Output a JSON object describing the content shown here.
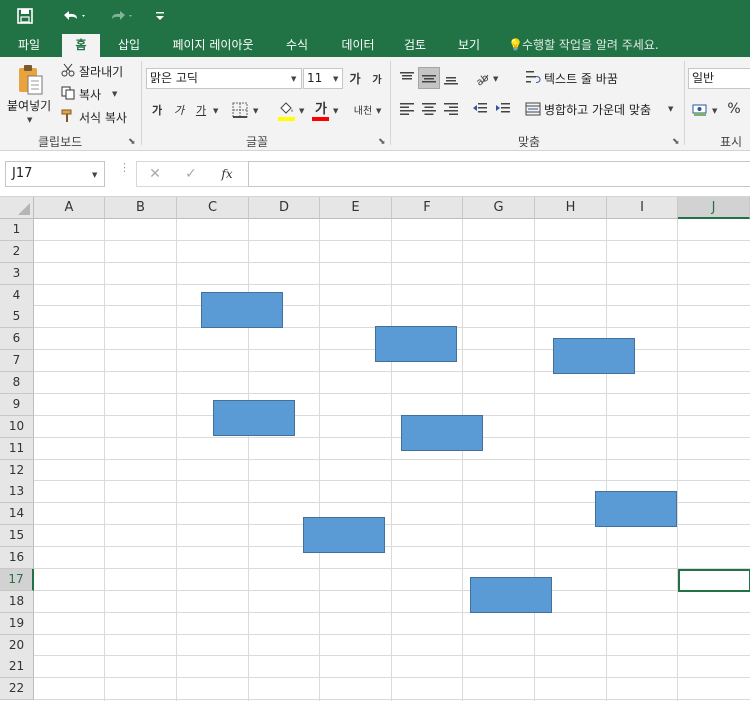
{
  "quick_access": {
    "save_icon": "save-icon",
    "undo_icon": "undo-icon",
    "redo_icon": "redo-icon",
    "customize_icon": "customize-qat-icon"
  },
  "tabs": [
    {
      "label": "파일"
    },
    {
      "label": "홈"
    },
    {
      "label": "삽입"
    },
    {
      "label": "페이지 레이아웃"
    },
    {
      "label": "수식"
    },
    {
      "label": "데이터"
    },
    {
      "label": "검토"
    },
    {
      "label": "보기"
    }
  ],
  "tell_me": "수행할 작업을 알려 주세요.",
  "ribbon": {
    "clipboard": {
      "paste_label": "붙여넣기",
      "cut_label": "잘라내기",
      "copy_label": "복사",
      "format_painter_label": "서식 복사",
      "group_label": "클립보드"
    },
    "font": {
      "font_name": "맑은 고딕",
      "font_size": "11",
      "grow_glyph": "가",
      "shrink_glyph": "가",
      "bold_glyph": "가",
      "italic_glyph": "가",
      "underline_glyph": "가",
      "font_color_glyph": "가",
      "phonetic_glyph": "내천",
      "group_label": "글꼴",
      "fill_color": "#ffff00",
      "font_color": "#ff0000"
    },
    "alignment": {
      "wrap_label": "텍스트 줄 바꿈",
      "merge_label": "병합하고 가운데 맞춤",
      "group_label": "맞춤"
    },
    "number": {
      "format": "일반",
      "percent": "%",
      "group_label": "표시"
    }
  },
  "formula_bar": {
    "name_box": "J17",
    "cancel": "✕",
    "enter": "✓",
    "fx": "fx",
    "formula": ""
  },
  "grid": {
    "columns": [
      "A",
      "B",
      "C",
      "D",
      "E",
      "F",
      "G",
      "H",
      "I",
      "J"
    ],
    "rows": [
      "1",
      "2",
      "3",
      "4",
      "5",
      "6",
      "7",
      "8",
      "9",
      "10",
      "11",
      "12",
      "13",
      "14",
      "15",
      "16",
      "17",
      "18",
      "19",
      "20",
      "21",
      "22"
    ],
    "selected_cell": "J17",
    "shape_count": 8,
    "shape_fill": "#5b9bd5"
  },
  "colors": {
    "accent": "#217346",
    "ribbon_bg": "#f3f3f3"
  }
}
